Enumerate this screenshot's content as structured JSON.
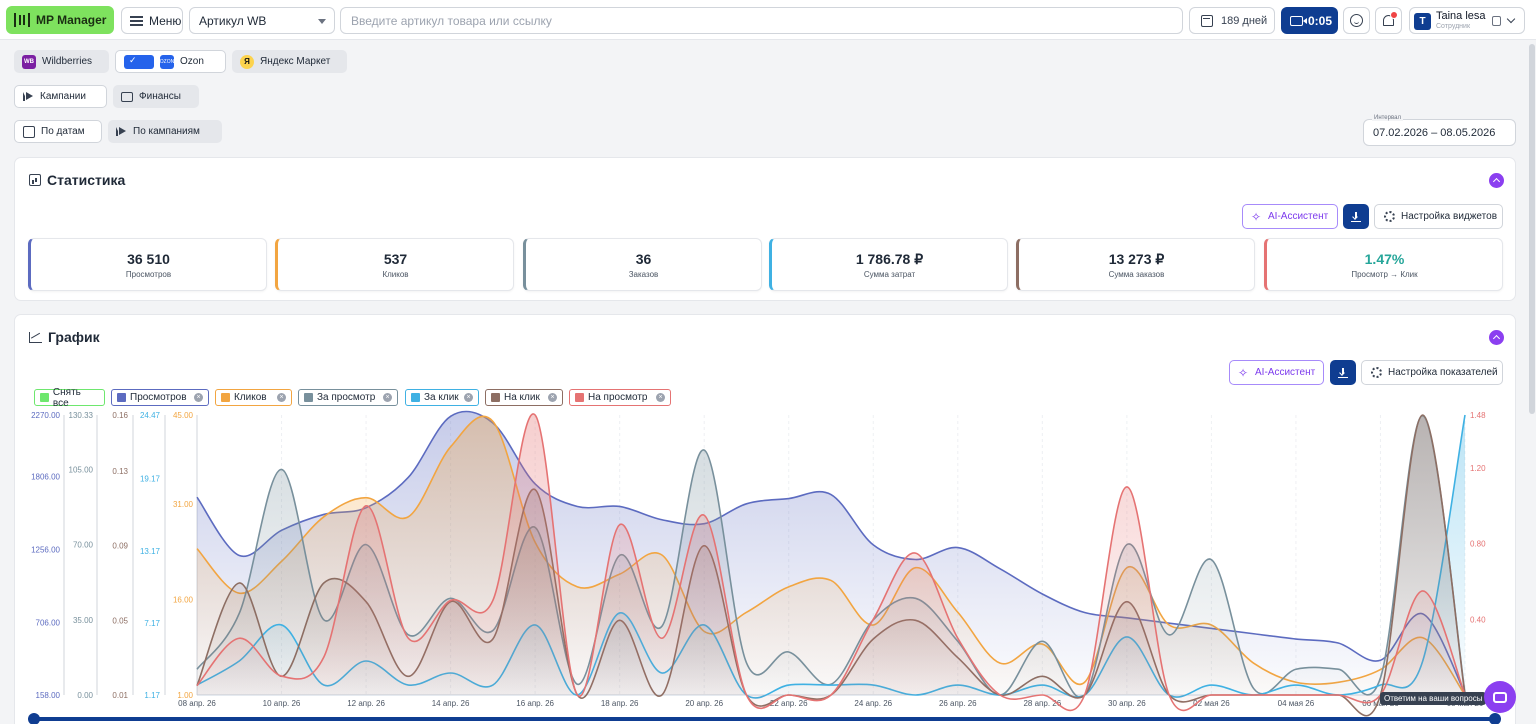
{
  "topbar": {
    "logo": "MP Manager",
    "menu": "Меню",
    "article_select": "Артикул WB",
    "search_placeholder": "Введите артикул товара или ссылку",
    "days": "189 дней",
    "timer": "0:05",
    "user_name": "Taina lesa",
    "user_role": "Сотрудник",
    "user_initial": "T"
  },
  "marketplaces": {
    "wb": "Wildberries",
    "wb_badge": "WB",
    "ozon": "Ozon",
    "ozon_badge": "OZON",
    "ym": "Яндекс Маркет",
    "ym_badge": "Я"
  },
  "tabs": {
    "campaigns": "Кампании",
    "finance": "Финансы"
  },
  "views": {
    "by_dates": "По датам",
    "by_campaigns": "По кампаниям"
  },
  "interval": {
    "label": "Интервал",
    "value": "07.02.2026 – 08.05.2026"
  },
  "stats": {
    "title": "Статистика",
    "ai_label": "AI-Ассистент",
    "settings_label": "Настройка виджетов",
    "kpis": [
      {
        "value": "36 510",
        "label": "Просмотров",
        "color": "#5c6bc0"
      },
      {
        "value": "537",
        "label": "Кликов",
        "color": "#f2a541"
      },
      {
        "value": "36",
        "label": "Заказов",
        "color": "#78909c"
      },
      {
        "value": "1 786.78 ₽",
        "label": "Сумма затрат",
        "color": "#3fb1e3"
      },
      {
        "value": "13 273 ₽",
        "label": "Сумма заказов",
        "color": "#8d6e63"
      },
      {
        "value": "1.47%",
        "label": "Просмотр → Клик",
        "color": "#e57373",
        "value_color": "#26a69a"
      }
    ]
  },
  "graph": {
    "title": "График",
    "ai_label": "AI-Ассистент",
    "settings_label": "Настройка показателей",
    "legend": [
      {
        "label": "Снять все",
        "color": "#6ee76e",
        "closable": false
      },
      {
        "label": "Просмотров",
        "color": "#5c6bc0",
        "closable": true
      },
      {
        "label": "Кликов",
        "color": "#f2a541",
        "closable": true
      },
      {
        "label": "За просмотр",
        "color": "#78909c",
        "closable": true
      },
      {
        "label": "За клик",
        "color": "#3fb1e3",
        "closable": true
      },
      {
        "label": "На клик",
        "color": "#8d6e63",
        "closable": true
      },
      {
        "label": "На просмотр",
        "color": "#e57373",
        "closable": true
      }
    ]
  },
  "help_tip": "Ответим на ваши вопросы",
  "chart_data": {
    "type": "area",
    "x": [
      "08 апр. 26",
      "09 апр. 26",
      "10 апр. 26",
      "11 апр. 26",
      "12 апр. 26",
      "13 апр. 26",
      "14 апр. 26",
      "15 апр. 26",
      "16 апр. 26",
      "17 апр. 26",
      "18 апр. 26",
      "19 апр. 26",
      "20 апр. 26",
      "21 апр. 26",
      "22 апр. 26",
      "23 апр. 26",
      "24 апр. 26",
      "25 апр. 26",
      "26 апр. 26",
      "27 апр. 26",
      "28 апр. 26",
      "29 апр. 26",
      "30 апр. 26",
      "01 мая 26",
      "02 мая 26",
      "03 мая 26",
      "04 мая 26",
      "05 мая 26",
      "06 мая 26",
      "07 мая 26",
      "08 мая 26"
    ],
    "x_tick_labels": [
      "08 апр. 26",
      "10 апр. 26",
      "12 апр. 26",
      "14 апр. 26",
      "16 апр. 26",
      "18 апр. 26",
      "20 апр. 26",
      "22 апр. 26",
      "24 апр. 26",
      "26 апр. 26",
      "28 апр. 26",
      "30 апр. 26",
      "02 мая 26",
      "04 мая 26",
      "06 мая 26",
      "08 мая 26"
    ],
    "axes": [
      {
        "series": "Просмотров",
        "color": "#5c6bc0",
        "ticks": [
          "2270.00",
          "1806.00",
          "1256.00",
          "706.00",
          "158.00"
        ],
        "ylim": [
          158,
          2270
        ]
      },
      {
        "series": "За просмотр",
        "color": "#78909c",
        "ticks": [
          "130.33",
          "105.00",
          "70.00",
          "35.00",
          "0.00"
        ],
        "ylim": [
          0,
          130.33
        ]
      },
      {
        "series": "На клик",
        "color": "#8d6e63",
        "ticks": [
          "0.16",
          "0.13",
          "0.09",
          "0.05",
          "0.01"
        ],
        "ylim": [
          0.01,
          0.16
        ]
      },
      {
        "series": "За клик",
        "color": "#3fb1e3",
        "ticks": [
          "24.47",
          "19.17",
          "13.17",
          "7.17",
          "1.17"
        ],
        "ylim": [
          1.17,
          24.47
        ]
      },
      {
        "series": "Кликов",
        "color": "#f2a541",
        "ticks": [
          "45.00",
          "31.00",
          "16.00",
          "1.00"
        ],
        "ylim": [
          1,
          45
        ]
      },
      {
        "series": "На просмотр",
        "color": "#e57373",
        "ticks": [
          "1.48",
          "1.20",
          "0.80",
          "0.40"
        ],
        "ylim": [
          0,
          1.48
        ],
        "side": "right"
      }
    ],
    "series": [
      {
        "name": "Просмотров",
        "color": "#5c6bc0",
        "values": [
          1650,
          1210,
          1400,
          1520,
          1570,
          1800,
          2260,
          2210,
          1750,
          1580,
          1580,
          1480,
          1450,
          1600,
          1640,
          1670,
          1290,
          1180,
          1270,
          1110,
          920,
          780,
          740,
          700,
          660,
          620,
          580,
          550,
          420,
          770,
          170
        ]
      },
      {
        "name": "Кликов",
        "color": "#f2a541",
        "values": [
          24,
          17,
          22,
          29,
          32,
          29,
          40,
          44,
          25,
          18,
          20,
          23,
          11,
          14,
          18,
          19,
          12,
          21,
          14,
          6,
          9,
          3,
          21,
          12,
          12,
          6,
          3,
          3,
          5,
          10,
          1
        ]
      },
      {
        "name": "За просмотр",
        "color": "#78909c",
        "values": [
          12,
          38,
          105,
          35,
          70,
          28,
          45,
          30,
          78,
          5,
          65,
          32,
          114,
          15,
          20,
          5,
          35,
          45,
          25,
          0,
          25,
          0,
          70,
          28,
          63,
          3,
          12,
          12,
          8,
          130,
          1
        ]
      },
      {
        "name": "За клик",
        "color": "#3fb1e3",
        "values": [
          2,
          4,
          7,
          2,
          4,
          2,
          3,
          2,
          7,
          1,
          8,
          3,
          7,
          1,
          2,
          2,
          2,
          1,
          2,
          1,
          2,
          1,
          6,
          1,
          2,
          1,
          2,
          1,
          2,
          4,
          24.47
        ]
      },
      {
        "name": "На клик",
        "color": "#8d6e63",
        "values": [
          0.015,
          0.07,
          0.02,
          0.07,
          0.06,
          0.02,
          0.06,
          0.04,
          0.12,
          0.01,
          0.05,
          0.01,
          0.09,
          0.01,
          0.01,
          0.01,
          0.04,
          0.05,
          0.03,
          0.01,
          0.02,
          0.01,
          0.06,
          0.01,
          0.01,
          0.01,
          0.01,
          0.01,
          0.01,
          0.16,
          0.01
        ]
      },
      {
        "name": "На просмотр",
        "color": "#e57373",
        "values": [
          0.05,
          0.3,
          0.1,
          0.2,
          1.0,
          0.3,
          0.5,
          0.5,
          1.48,
          0,
          0.9,
          0.3,
          0.95,
          0,
          0,
          0,
          0.4,
          0.75,
          0.3,
          0,
          0,
          0,
          1.1,
          0,
          0,
          0,
          0,
          0,
          0,
          0.55,
          0
        ]
      }
    ]
  }
}
